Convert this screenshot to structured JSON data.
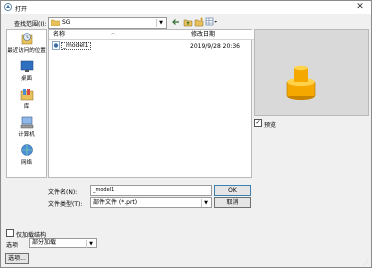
{
  "window": {
    "title": "打开",
    "close_glyph": "✕"
  },
  "lookin": {
    "label": "查找范围(I):",
    "value": "SG"
  },
  "toolbar": {
    "icons": [
      "back-icon",
      "up-folder-icon",
      "new-folder-icon",
      "view-menu-icon"
    ]
  },
  "places": [
    {
      "label": "最近访问的位置",
      "icon": "recent-icon"
    },
    {
      "label": "桌面",
      "icon": "desktop-icon"
    },
    {
      "label": "库",
      "icon": "library-icon"
    },
    {
      "label": "计算机",
      "icon": "computer-icon"
    },
    {
      "label": "网络",
      "icon": "network-icon"
    }
  ],
  "filelist": {
    "columns": [
      "名称",
      "修改日期"
    ],
    "files": [
      {
        "name": "_model1",
        "modified": "2019/9/28 20:36"
      }
    ]
  },
  "preview": {
    "checkbox_label": "预览",
    "checked": true,
    "check_glyph": "✓",
    "background": "#d9d9d9",
    "part_color": "#f5a800"
  },
  "filename": {
    "label": "文件名(N):",
    "value": "_model1"
  },
  "filetype": {
    "label": "文件类型(T):",
    "value": "部件文件 (*.prt)"
  },
  "buttons": {
    "ok": "OK",
    "cancel": "取消",
    "options": "选项..."
  },
  "load_structure": {
    "label": "仅加载结构",
    "checked": false
  },
  "options": {
    "label": "选项",
    "value": "部分加载"
  }
}
